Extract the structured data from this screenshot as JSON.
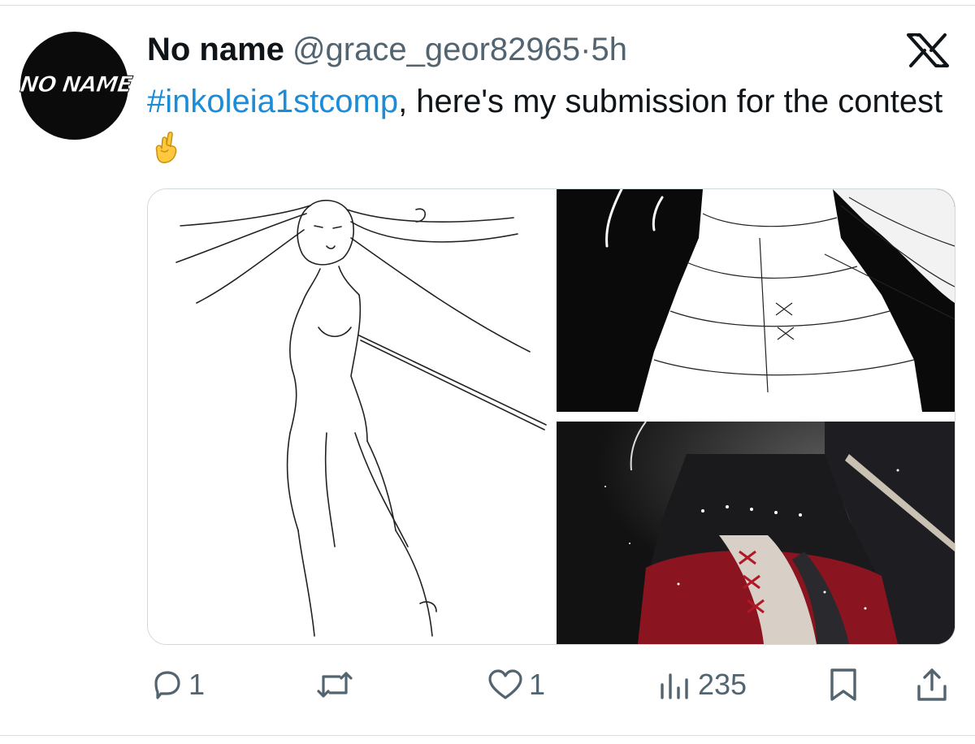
{
  "author": {
    "avatar_text": "NO NAME",
    "display_name": "No name",
    "handle": "@grace_geor82965",
    "separator": "·",
    "time": "5h"
  },
  "tweet": {
    "hashtag": "#inkoleia1stcomp",
    "text_after_hashtag": ", here's my submission for the contest",
    "emoji": "crossed-fingers-emoji"
  },
  "media": {
    "images": [
      "line-art-full-figure",
      "line-art-dress-closeup",
      "colored-dress-closeup"
    ]
  },
  "actions": {
    "reply_count": "1",
    "retweet_count": "",
    "like_count": "1",
    "views_count": "235"
  },
  "icons": [
    "x-logo-icon",
    "reply-icon",
    "retweet-icon",
    "like-icon",
    "views-icon",
    "bookmark-icon",
    "share-icon"
  ],
  "colors": {
    "hashtag": "#1a8cd8",
    "secondary": "#536471",
    "text": "#0f1419"
  }
}
